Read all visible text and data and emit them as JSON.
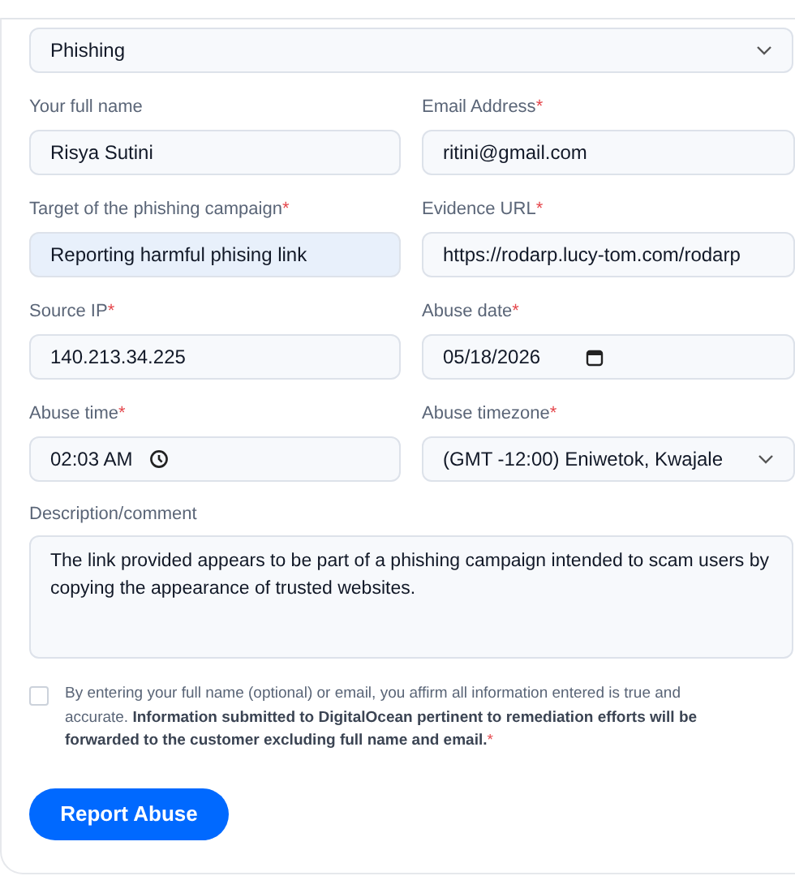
{
  "category": {
    "value": "Phishing"
  },
  "fields": [
    {
      "kind": "text",
      "label": "Your full name",
      "focused": false,
      "value": "Risya Sutini"
    },
    {
      "kind": "text",
      "label": "Email Address",
      "required_mark": "*",
      "focused": false,
      "value": "ritini@gmail.com"
    },
    {
      "kind": "text",
      "label": "Target of the phishing campaign",
      "required_mark": "*",
      "focused": true,
      "value": "Reporting harmful phising link"
    },
    {
      "kind": "text",
      "label": "Evidence URL",
      "required_mark": "*",
      "focused": false,
      "value": "https://rodarp.lucy-tom.com/rodarp"
    },
    {
      "kind": "text",
      "label": "Source IP",
      "required_mark": "*",
      "focused": false,
      "value": "140.213.34.225"
    },
    {
      "kind": "date",
      "label": "Abuse date",
      "required_mark": "*",
      "focused": false,
      "value": "05/18/2026"
    },
    {
      "kind": "time",
      "label": "Abuse time",
      "required_mark": "*",
      "focused": false,
      "value": "02:03 AM"
    },
    {
      "kind": "select",
      "label": "Abuse timezone",
      "required_mark": "*",
      "focused": false,
      "value": "(GMT -12:00) Eniwetok, Kwajale"
    }
  ],
  "description": {
    "label": "Description/comment",
    "value": "The link provided appears to be part of a phishing campaign intended to scam users by copying the appearance of trusted websites."
  },
  "consent": {
    "checked": false,
    "required_mark": "*",
    "text": "By entering your full name (optional) or email, you affirm all information entered is true and accurate. **Information submitted to DigitalOcean pertinent to remediation efforts will be forwarded to the customer excluding full name and email.**"
  },
  "submit_button": "Report Abuse"
}
